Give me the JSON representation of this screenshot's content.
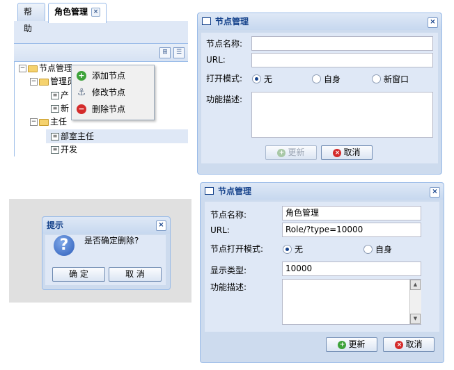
{
  "tabs": {
    "help": "帮助",
    "role_mgmt": "角色管理",
    "close": "×"
  },
  "tree": {
    "root": "节点管理",
    "group1": "管理员",
    "child1": "产",
    "child2": "新",
    "group2": "主任",
    "leaf1": "部室主任",
    "leaf2": "开发"
  },
  "context_menu": {
    "add": "添加节点",
    "edit": "修改节点",
    "delete": "删除节点"
  },
  "dialog_top": {
    "title": "节点管理",
    "name_label": "节点名称:",
    "url_label": "URL:",
    "mode_label": "打开模式:",
    "opt_none": "无",
    "opt_self": "自身",
    "opt_new": "新窗口",
    "desc_label": "功能描述:",
    "update": "更新",
    "cancel": "取消"
  },
  "confirm": {
    "title": "提示",
    "message": "是否确定删除?",
    "ok": "确 定",
    "cancel": "取 消"
  },
  "dialog_bottom": {
    "title": "节点管理",
    "name_label": "节点名称:",
    "name_value": "角色管理",
    "url_label": "URL:",
    "url_value": "Role/?type=10000",
    "mode_label": "节点打开模式:",
    "opt_none": "无",
    "opt_self": "自身",
    "type_label": "显示类型:",
    "type_value": "10000",
    "desc_label": "功能描述:",
    "update": "更新",
    "cancel": "取消"
  },
  "icons": {
    "close": "close-icon",
    "question": "question-icon",
    "add": "add-icon",
    "edit": "anchor-icon",
    "delete": "delete-icon"
  },
  "colors": {
    "accent": "#15428b",
    "panel": "#dfe8f6",
    "border": "#99bbe8",
    "cancel_red": "#d42b2b",
    "add_green": "#3ea33a"
  }
}
